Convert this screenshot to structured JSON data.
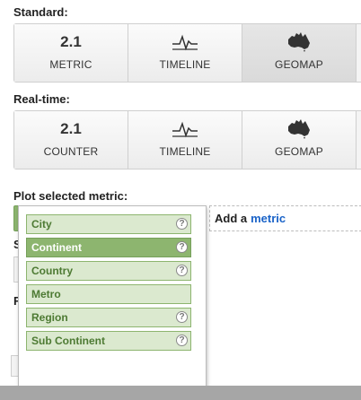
{
  "standard": {
    "label": "Standard:",
    "tiles": [
      {
        "number": "2.1",
        "label": "METRIC",
        "icon": "number"
      },
      {
        "number": "",
        "label": "TIMELINE",
        "icon": "timeline-icon"
      },
      {
        "number": "",
        "label": "GEOMAP",
        "icon": "australia-map-icon"
      }
    ]
  },
  "realtime": {
    "label": "Real-time:",
    "tiles": [
      {
        "number": "2.1",
        "label": "COUNTER",
        "icon": "number"
      },
      {
        "number": "",
        "label": "TIMELINE",
        "icon": "timeline-icon"
      },
      {
        "number": "",
        "label": "GEOMAP",
        "icon": "australia-map-icon"
      }
    ]
  },
  "plot": {
    "label": "Plot selected metric:",
    "add_prefix": "Add a",
    "add_link": "metric"
  },
  "dropdown": {
    "options": [
      {
        "label": "City",
        "help": "?"
      },
      {
        "label": "Continent",
        "help": "?",
        "selected": true
      },
      {
        "label": "Country",
        "help": "?"
      },
      {
        "label": "Metro",
        "help": ""
      },
      {
        "label": "Region",
        "help": "?"
      },
      {
        "label": "Sub Continent",
        "help": "?"
      }
    ]
  },
  "partial_labels": {
    "s": "S",
    "f": "F"
  },
  "colors": {
    "accent_green": "#8db56f",
    "option_bg": "#dbe9cf",
    "link_blue": "#1a63c8"
  }
}
